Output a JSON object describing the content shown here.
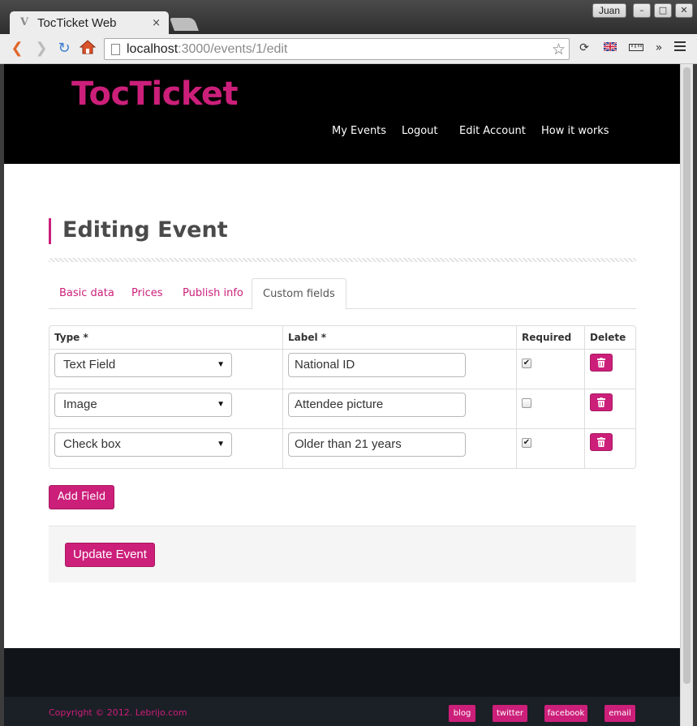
{
  "browser": {
    "tab_title": "TocTicket Web",
    "tab_close": "×",
    "user_label": "Juan",
    "url_host": "localhost",
    "url_path": ":3000/events/1/edit",
    "overflow": "»",
    "window_buttons": {
      "minimize": "–",
      "maximize": "□",
      "close": "✕"
    }
  },
  "header": {
    "logo": "TocTicket",
    "nav": [
      "My Events",
      "Logout",
      "Edit Account",
      "How it works"
    ]
  },
  "page": {
    "title": "Editing Event",
    "tabs": [
      "Basic data",
      "Prices",
      "Publish info",
      "Custom fields"
    ],
    "active_tab": "Custom fields"
  },
  "table": {
    "headers": {
      "type": "Type *",
      "label": "Label *",
      "required": "Required",
      "delete": "Delete"
    },
    "rows": [
      {
        "type": "Text Field",
        "label": "National ID",
        "required": true
      },
      {
        "type": "Image",
        "label": "Attendee picture",
        "required": false
      },
      {
        "type": "Check box",
        "label": "Older than 21 years",
        "required": true
      }
    ]
  },
  "buttons": {
    "add_field": "Add Field",
    "update_event": "Update Event"
  },
  "footer": {
    "copyright": "Copyright © 2012. Lebrijo.com",
    "links": [
      "blog",
      "twitter",
      "facebook",
      "email"
    ]
  },
  "colors": {
    "accent": "#cc1f7a",
    "header_bg": "#000000",
    "footer_bg": "#111418"
  }
}
